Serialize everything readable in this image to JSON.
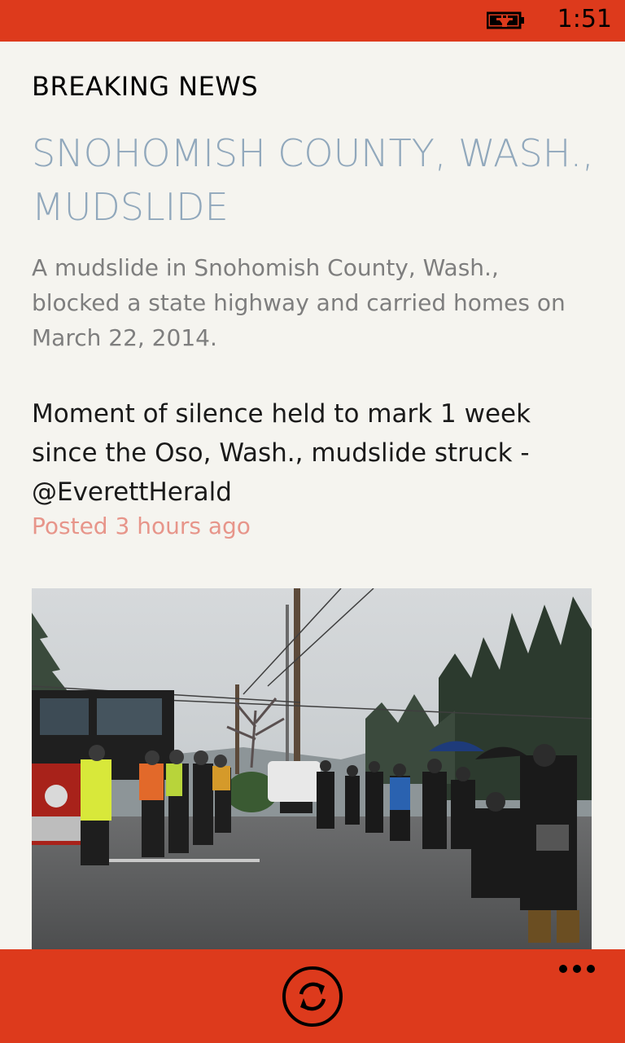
{
  "status_bar": {
    "time": "1:51",
    "battery_icon": "battery-charging-icon",
    "color": "#dd3a1c"
  },
  "article": {
    "section_label": "BREAKING NEWS",
    "headline": "SNOHOMISH COUNTY, WASH., MUDSLIDE",
    "summary": "A mudslide in Snohomish County, Wash., blocked a state highway and carried homes on March 22, 2014.",
    "update_text": "Moment of silence held to mark 1 week since the Oso, Wash., mudslide struck - @EverettHerald",
    "posted": "Posted 3 hours ago",
    "photo_icon": "news-photo"
  },
  "app_bar": {
    "refresh_icon": "refresh-icon",
    "more_icon": "more-ellipsis-icon",
    "color": "#dd3a1c"
  }
}
